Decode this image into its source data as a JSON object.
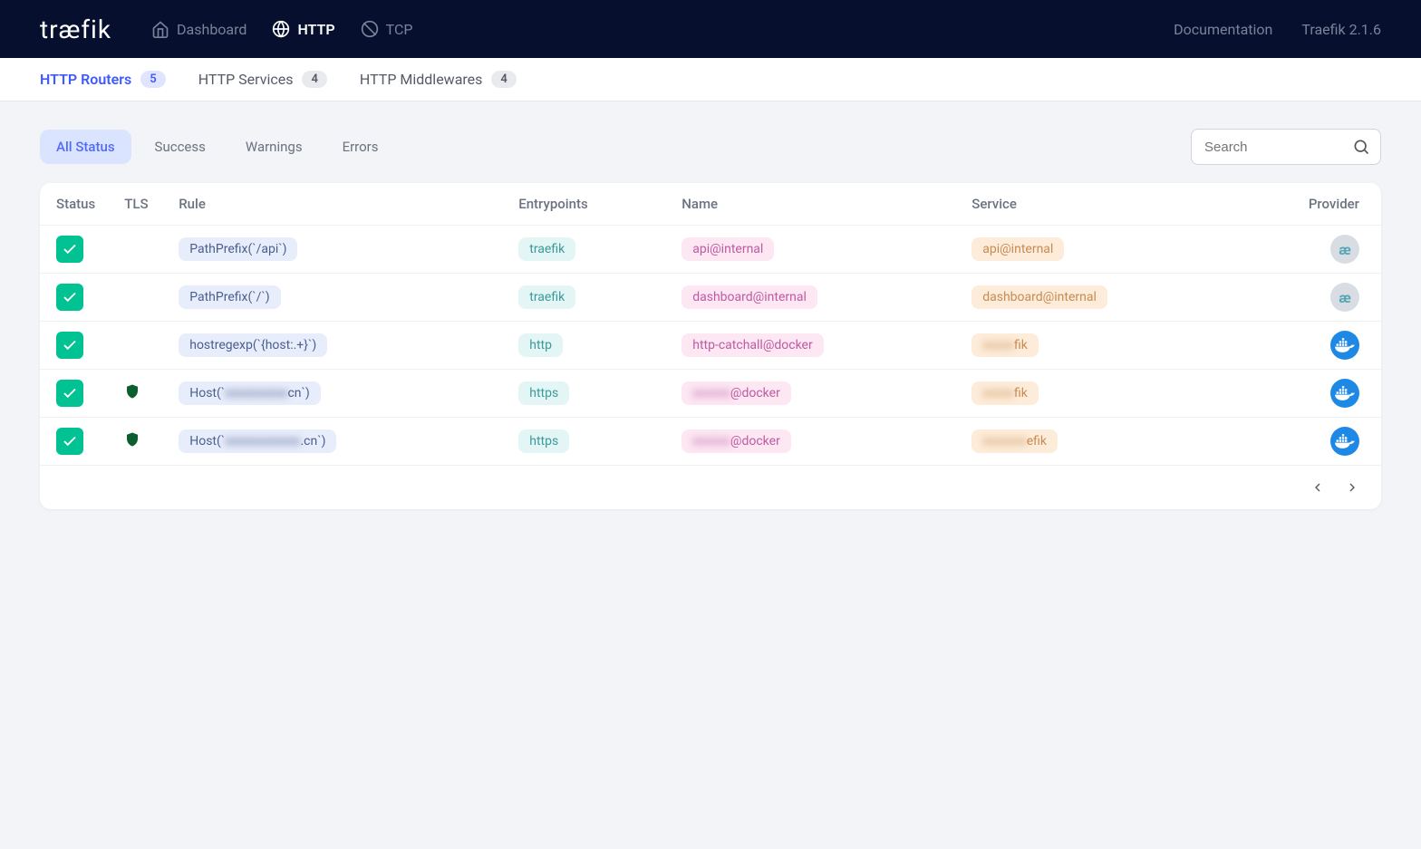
{
  "nav": {
    "logo_pre": "tr",
    "logo_ae": "æ",
    "logo_post": "fik",
    "items": [
      {
        "label": "Dashboard",
        "active": false
      },
      {
        "label": "HTTP",
        "active": true
      },
      {
        "label": "TCP",
        "active": false
      }
    ],
    "doc": "Documentation",
    "version": "Traefik 2.1.6"
  },
  "subtabs": [
    {
      "label": "HTTP Routers",
      "count": "5",
      "active": true
    },
    {
      "label": "HTTP Services",
      "count": "4",
      "active": false
    },
    {
      "label": "HTTP Middlewares",
      "count": "4",
      "active": false
    }
  ],
  "filters": {
    "all": "All Status",
    "success": "Success",
    "warnings": "Warnings",
    "errors": "Errors"
  },
  "search": {
    "placeholder": "Search"
  },
  "table": {
    "headers": {
      "status": "Status",
      "tls": "TLS",
      "rule": "Rule",
      "entrypoints": "Entrypoints",
      "name": "Name",
      "service": "Service",
      "provider": "Provider"
    },
    "rows": [
      {
        "tls": false,
        "rule": "PathPrefix(`/api`)",
        "ep": "traefik",
        "name": "api@internal",
        "service": "api@internal",
        "provider": "internal"
      },
      {
        "tls": false,
        "rule": "PathPrefix(`/`)",
        "ep": "traefik",
        "name": "dashboard@internal",
        "service": "dashboard@internal",
        "provider": "internal"
      },
      {
        "tls": false,
        "rule": "hostregexp(`{host:.+}`)",
        "ep": "http",
        "name": "http-catchall@docker",
        "service_pre": "xxxxx",
        "service_post": "fik",
        "provider": "docker"
      },
      {
        "tls": true,
        "rule_pre": "Host(`",
        "rule_mid": "xxxxxxxxxx",
        "rule_post": "cn`)",
        "ep": "https",
        "name_pre": "xxxxxx",
        "name_post": "@docker",
        "service_pre": "xxxxx",
        "service_post": "fik",
        "provider": "docker"
      },
      {
        "tls": true,
        "rule_pre": "Host(`",
        "rule_mid": "xxxxxxxxxxxx",
        "rule_post": ".cn`)",
        "ep": "https",
        "name_pre": "xxxxxx",
        "name_post": "@docker",
        "service_pre": "xxxxxxx",
        "service_post": "efik",
        "provider": "docker"
      }
    ]
  }
}
